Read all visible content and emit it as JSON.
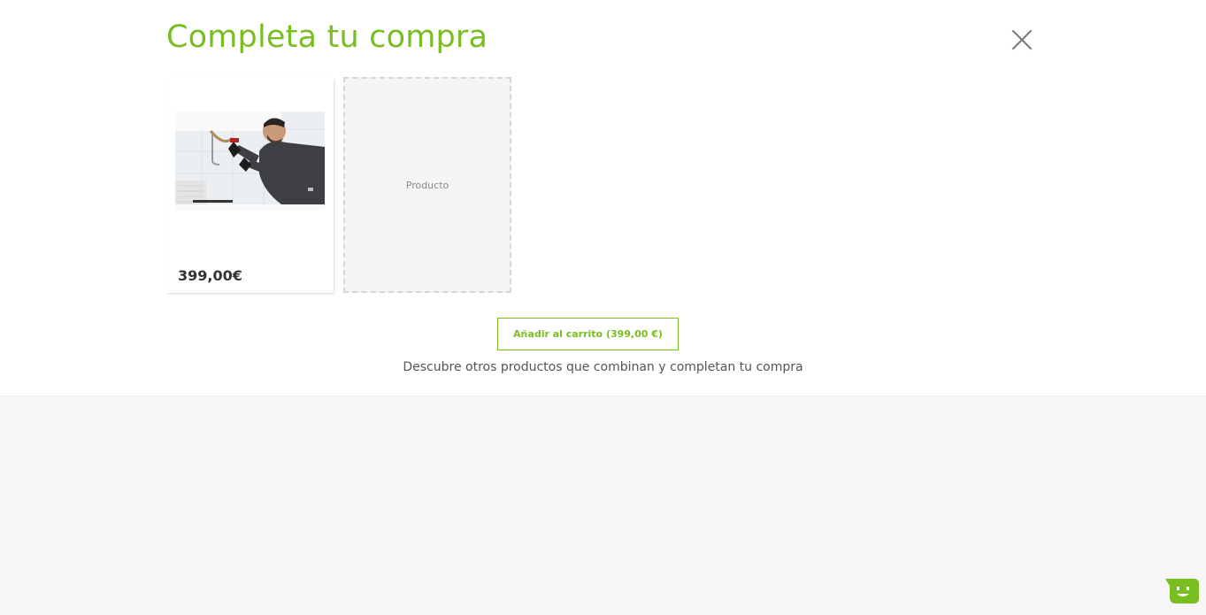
{
  "modal": {
    "title": "Completa tu compra",
    "close_icon": "close-icon"
  },
  "product": {
    "image_icon": "plumber-photo",
    "price": "399,00€"
  },
  "placeholder": {
    "label": "Producto"
  },
  "add_to_cart": {
    "label": "Añadir al carrito (399,00 €)"
  },
  "subtitle": "Descubre otros productos que combinan y completan tu compra",
  "chat": {
    "icon": "chat-bot-icon"
  },
  "colors": {
    "accent": "#78be20",
    "page_bg": "#f6f6f6",
    "panel_bg": "#ffffff"
  }
}
